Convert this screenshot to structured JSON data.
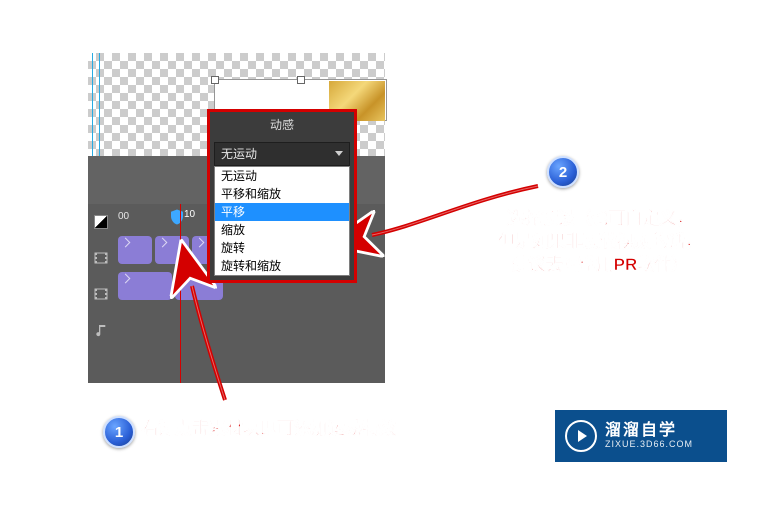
{
  "popup": {
    "title": "动感",
    "combo_value": "无运动",
    "options": [
      "无运动",
      "平移和缩放",
      "平移",
      "缩放",
      "旋转",
      "旋转和缩放"
    ],
    "selected_index": 2
  },
  "timeline": {
    "time_label": "00",
    "shield_value": "10"
  },
  "annotations": {
    "badge1": "1",
    "badge2": "2",
    "text1": "右键点击素材块即可添加运动特效",
    "text2_line1": "选择预设（也可自定义，",
    "text2_line2": "但是如果非要做视频的话，",
    "text2_line3": "建议去隔壁用PR软件）"
  },
  "watermark": {
    "name": "溜溜自学",
    "url": "ZIXUE.3D66.COM"
  },
  "icons": {
    "contrast": "contrast-icon",
    "film": "film-icon",
    "music": "music-icon",
    "shield": "shield-icon",
    "chevron": "chevron-down-icon",
    "play": "play-icon"
  }
}
